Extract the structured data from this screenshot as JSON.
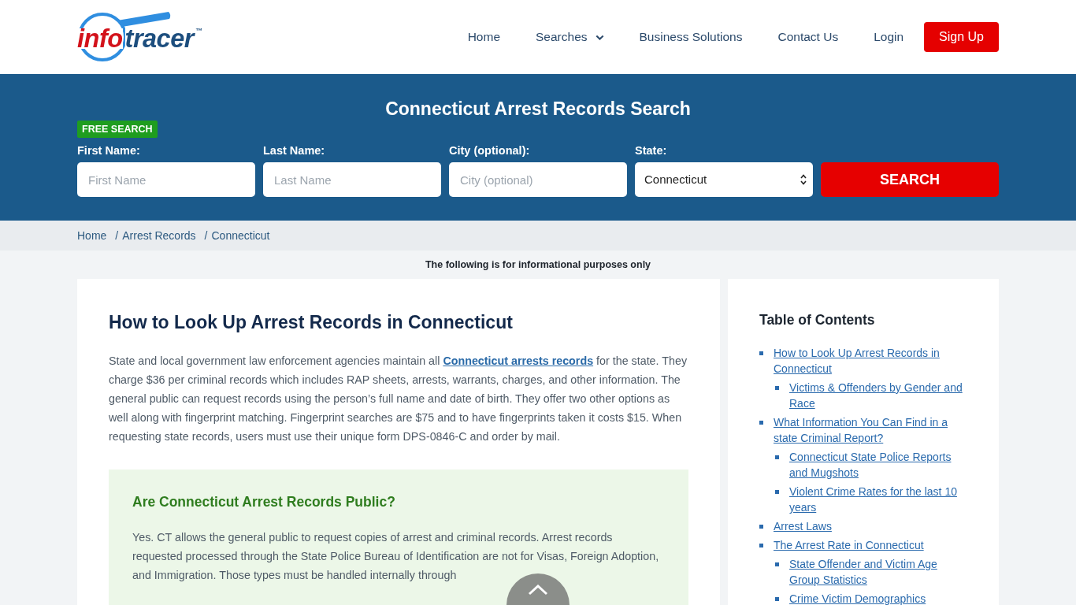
{
  "header": {
    "logo": {
      "word_1": "info",
      "word_2": "tracer",
      "trademark": "™"
    },
    "nav": [
      {
        "label": "Home",
        "kind": "link"
      },
      {
        "label": "Searches",
        "kind": "dropdown"
      },
      {
        "label": "Business Solutions",
        "kind": "link"
      },
      {
        "label": "Contact Us",
        "kind": "link"
      },
      {
        "label": "Login",
        "kind": "link"
      },
      {
        "label": "Sign Up",
        "kind": "button"
      }
    ]
  },
  "search": {
    "title": "Connecticut Arrest Records Search",
    "badge": "FREE SEARCH",
    "fields": [
      {
        "kind": "text",
        "label": "First Name:",
        "placeholder": "First Name"
      },
      {
        "kind": "text",
        "label": "Last Name:",
        "placeholder": "Last Name"
      },
      {
        "kind": "text",
        "label": "City (optional):",
        "placeholder": "City (optional)"
      },
      {
        "kind": "select",
        "label": "State:",
        "value": "Connecticut"
      }
    ],
    "button": "SEARCH"
  },
  "breadcrumb": [
    {
      "label": "Home"
    },
    {
      "separator": "/",
      "label": "Arrest Records"
    },
    {
      "separator": "/",
      "label": "Connecticut"
    }
  ],
  "notice": "The following is for informational purposes only",
  "article": {
    "heading": "How to Look Up Arrest Records in Connecticut",
    "paragraph": {
      "before": "State and local government law enforcement agencies maintain all ",
      "link": "Connecticut arrests records",
      "after": " for the state. They charge $36 per criminal records which includes RAP sheets, arrests, warrants, charges, and other information. The general public can request records using the person’s full name and date of birth. They offer two other options as well along with fingerprint matching. Fingerprint searches are $75 and to have fingerprints taken it costs $15. When requesting state records, users must use their unique form DPS-0846-C and order by mail."
    },
    "callout": {
      "heading": "Are Connecticut Arrest Records Public?",
      "paragraph": "Yes. CT allows the general public to request copies of arrest and criminal records. Arrest records requested processed through the State Police Bureau of Identification are not for Visas, Foreign Adoption, and Immigration. Those types must be handled internally through"
    }
  },
  "toc": {
    "title": "Table of Contents",
    "items": [
      {
        "label": "How to Look Up Arrest Records in Connecticut",
        "children": [
          {
            "label": "Victims & Offenders by Gender and Race"
          }
        ]
      },
      {
        "label": "What Information You Can Find in a state Criminal Report?",
        "children": [
          {
            "label": "Connecticut State Police Reports and Mugshots"
          },
          {
            "label": "Violent Crime Rates for the last 10 years"
          }
        ]
      },
      {
        "label": "Arrest Laws"
      },
      {
        "label": "The Arrest Rate in Connecticut",
        "children": [
          {
            "label": "State Offender and Victim Age Group Statistics"
          },
          {
            "label": "Crime Victim Demographics"
          }
        ]
      }
    ]
  }
}
